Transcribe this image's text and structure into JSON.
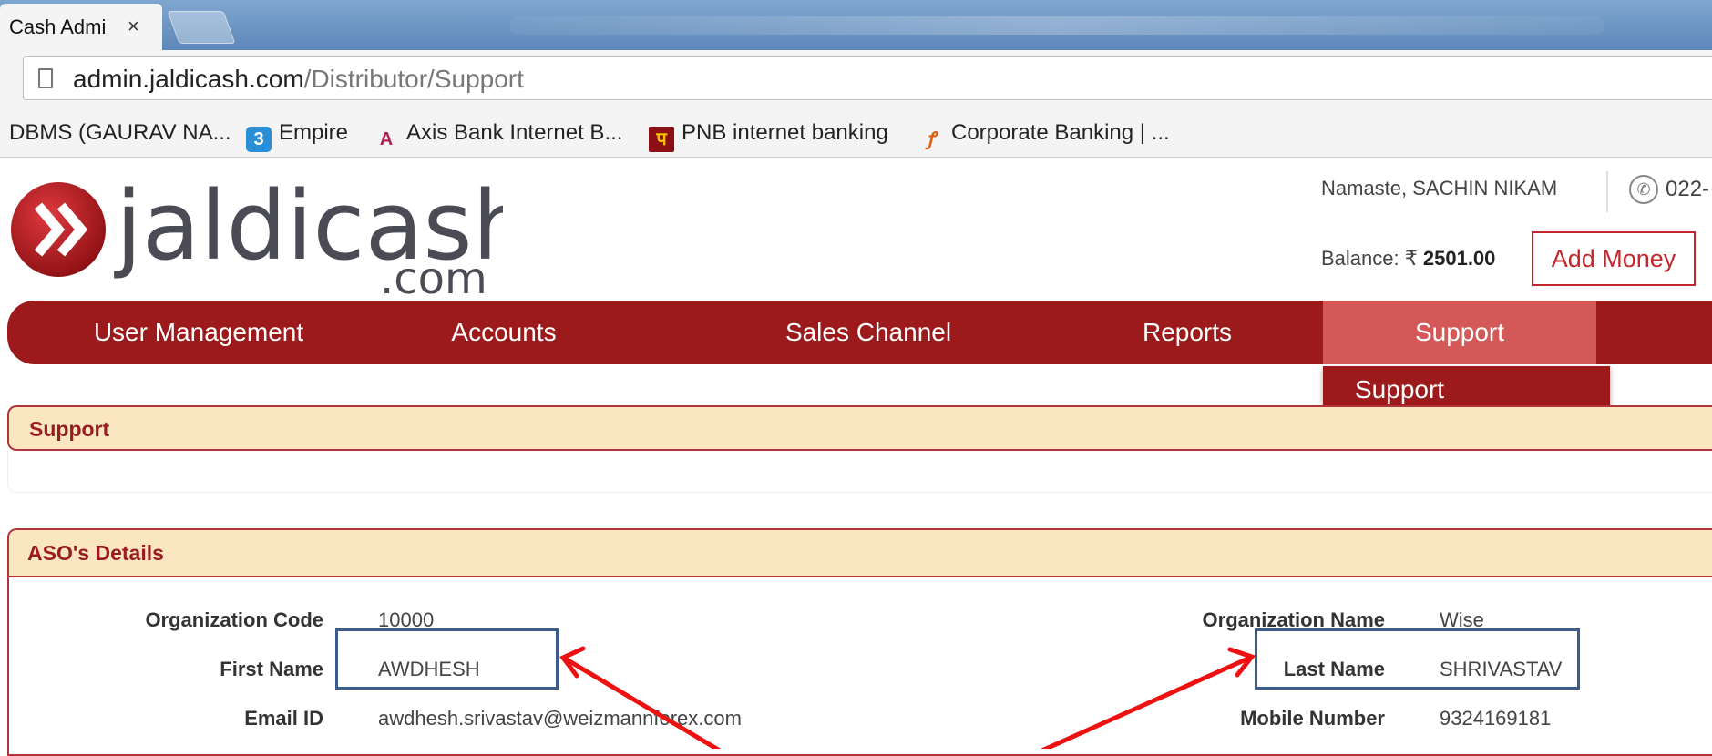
{
  "browser": {
    "tab_title": "Cash Admi",
    "close_glyph": "×",
    "url_host": "admin.jaldicash.com",
    "url_path": "/Distributor/Support",
    "bookmarks": [
      {
        "label": "DBMS (GAURAV NA...",
        "icon": "none"
      },
      {
        "label": "Empire",
        "icon": "empire-icon",
        "glyph": "3"
      },
      {
        "label": "Axis Bank Internet B...",
        "icon": "axis-bank-icon",
        "glyph": "A"
      },
      {
        "label": "PNB internet banking",
        "icon": "pnb-icon",
        "glyph": "प"
      },
      {
        "label": "Corporate Banking | ...",
        "icon": "corporate-banking-icon",
        "glyph": "ꝭ"
      }
    ]
  },
  "header": {
    "logo_text": "jaldicash",
    "logo_suffix": ".com",
    "greeting": "Namaste, SACHIN NIKAM",
    "phone": "022-",
    "balance_label": "Balance:",
    "currency": "₹",
    "balance_value": "2501.00",
    "add_money": "Add Money"
  },
  "nav": {
    "items": [
      {
        "label": "User Management"
      },
      {
        "label": "Accounts"
      },
      {
        "label": "Sales Channel"
      },
      {
        "label": "Reports"
      },
      {
        "label": "Support"
      }
    ],
    "active": "Support",
    "dropdown_item": "Support"
  },
  "support_panel": {
    "title": "Support"
  },
  "aso": {
    "title": "ASO's Details",
    "org_code_label": "Organization Code",
    "org_code": "10000",
    "org_name_label": "Organization Name",
    "org_name": "Wise",
    "first_name_label": "First Name",
    "first_name": "AWDHESH",
    "last_name_label": "Last Name",
    "last_name": "SHRIVASTAV",
    "email_label": "Email ID",
    "email": "awdhesh.srivastav@weizmannforex.com",
    "mobile_label": "Mobile Number",
    "mobile": "9324169181"
  },
  "colors": {
    "brand_red": "#9c1a1c",
    "active_nav": "#d45858",
    "panel_bg": "#fbe6c2",
    "annotation": "#ee1111",
    "highlight_box": "#3b5b8a"
  }
}
